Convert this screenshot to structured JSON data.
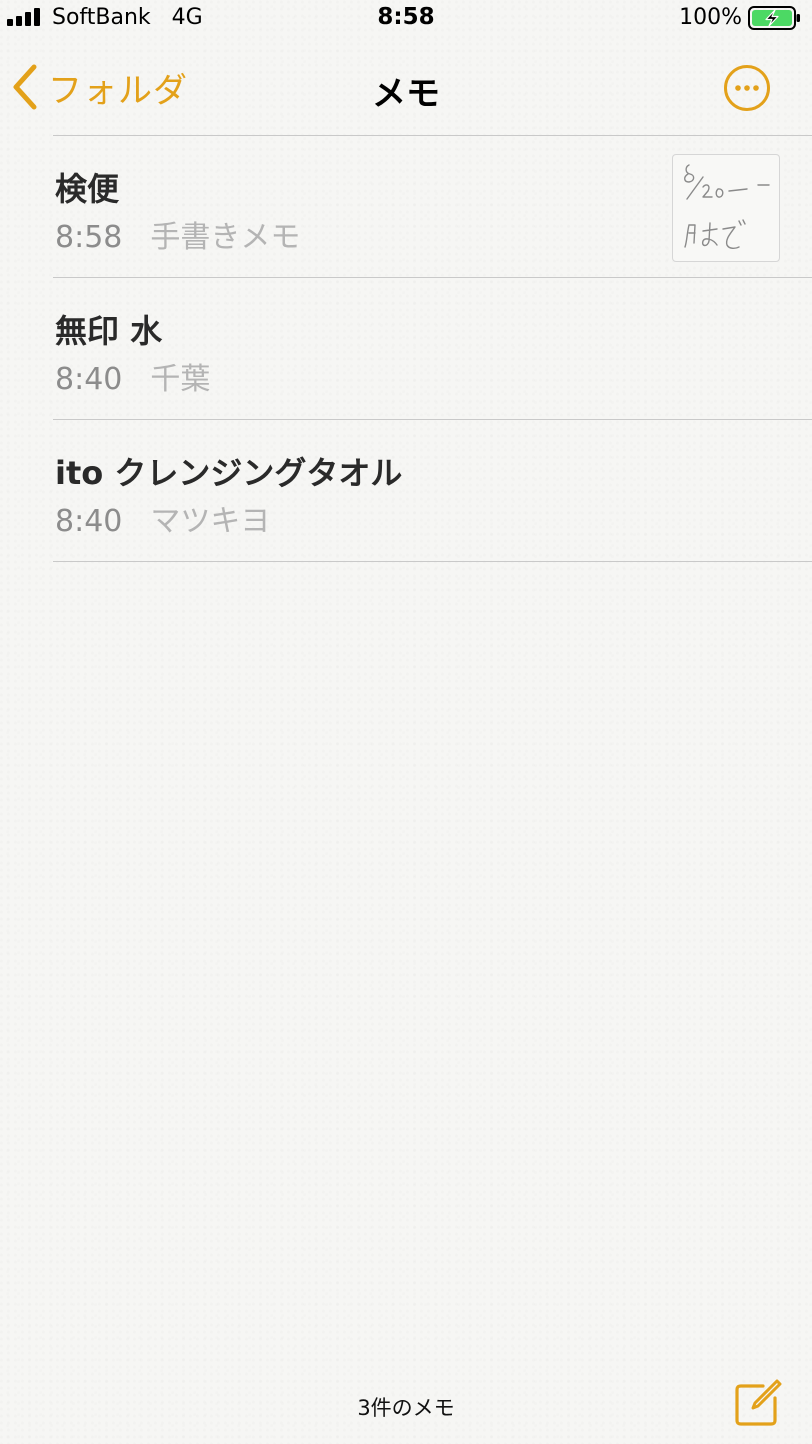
{
  "status_bar": {
    "carrier": "SoftBank",
    "network": "4G",
    "time": "8:58",
    "battery_percent": "100%",
    "battery_state": "charging"
  },
  "nav": {
    "back_label": "フォルダ",
    "title": "メモ",
    "more_icon": "ellipsis-circle-icon"
  },
  "notes": [
    {
      "title": "検便",
      "time": "8:58",
      "preview": "手書きメモ",
      "has_thumbnail": true,
      "thumbnail_icon": "handwriting-thumbnail-icon"
    },
    {
      "title": "無印 水",
      "time": "8:40",
      "preview": "千葉",
      "has_thumbnail": false
    },
    {
      "title": "ito クレンジングタオル",
      "time": "8:40",
      "preview": "マツキヨ",
      "has_thumbnail": false
    }
  ],
  "toolbar": {
    "note_count": "3件のメモ",
    "compose_icon": "compose-icon"
  },
  "colors": {
    "accent": "#e3a11a",
    "background": "#f6f6f4",
    "title_text": "#2a2a2a",
    "time_text": "#8c8c8c",
    "preview_text": "#b4b4b4",
    "divider": "#c9c9c9",
    "battery_fill": "#4cd964"
  }
}
